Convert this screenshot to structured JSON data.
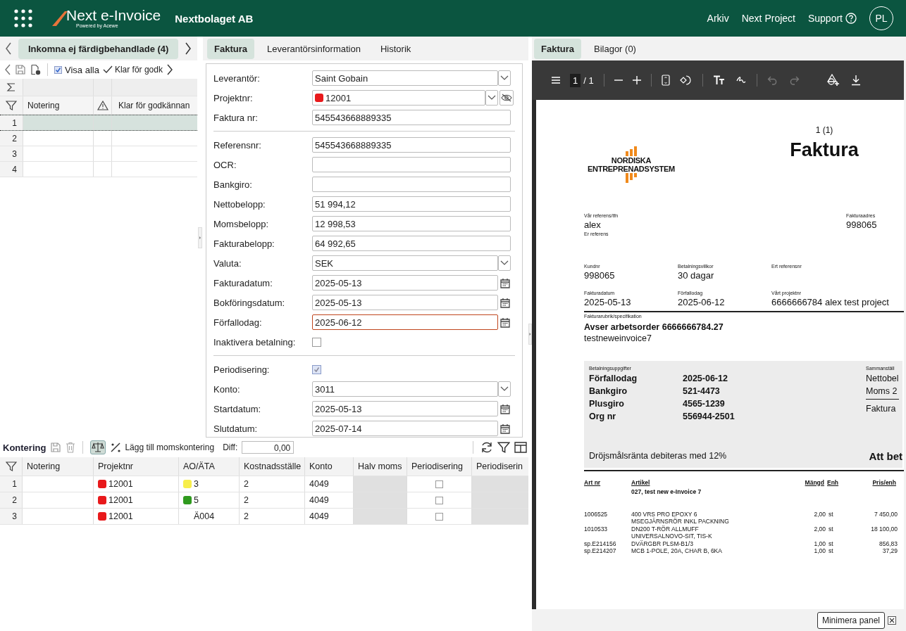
{
  "topbar": {
    "app_name": "Next e-Invoice",
    "powered_by": "Powered by Acewe",
    "company": "Nextbolaget AB",
    "links": [
      "Arkiv",
      "Next Project"
    ],
    "support": "Support",
    "avatar": "PL"
  },
  "list_panel": {
    "tab": "Inkomna ej färdigbehandlade (4)",
    "show_all": {
      "label": "Visa alla",
      "checked": true
    },
    "ready_button": "Klar för godk",
    "columns": [
      "Notering",
      "Klar för godkännan"
    ],
    "rows": [
      {
        "number": "1",
        "selected": true
      },
      {
        "number": "2",
        "selected": false
      },
      {
        "number": "3",
        "selected": false
      },
      {
        "number": "4",
        "selected": false
      }
    ]
  },
  "form_tabs": [
    {
      "label": "Faktura",
      "selected": true
    },
    {
      "label": "Leverantörsinformation",
      "selected": false
    },
    {
      "label": "Historik",
      "selected": false
    }
  ],
  "form_sections": [
    [
      {
        "kind": "select",
        "label": "Leverantör:",
        "value": "Saint Gobain"
      },
      {
        "kind": "project",
        "label": "Projektnr:",
        "value": "12001",
        "color": "#e8191b"
      },
      {
        "kind": "text",
        "label": "Faktura nr:",
        "value": "545543668889335"
      }
    ],
    [
      {
        "kind": "text",
        "label": "Referensnr:",
        "value": "545543668889335"
      },
      {
        "kind": "text",
        "label": "OCR:"
      },
      {
        "kind": "text",
        "label": "Bankgiro:"
      },
      {
        "kind": "text",
        "label": "Nettobelopp:",
        "value": "51 994,12"
      },
      {
        "kind": "text",
        "label": "Momsbelopp:",
        "value": "12 998,53"
      },
      {
        "kind": "text",
        "label": "Fakturabelopp:",
        "value": "64 992,65"
      },
      {
        "kind": "select",
        "label": "Valuta:",
        "value": "SEK"
      },
      {
        "kind": "date",
        "label": "Fakturadatum:",
        "value": "2025-05-13",
        "error": false
      },
      {
        "kind": "date",
        "label": "Bokföringsdatum:",
        "value": "2025-05-13",
        "error": false
      },
      {
        "kind": "date",
        "label": "Förfallodag:",
        "value": "2025-06-12",
        "error": true
      },
      {
        "kind": "checkbox",
        "label": "Inaktivera betalning:",
        "checked": false
      }
    ],
    [
      {
        "kind": "checkbox",
        "label": "Periodisering:",
        "checked": true
      },
      {
        "kind": "select",
        "label": "Konto:",
        "value": "3011"
      },
      {
        "kind": "date",
        "label": "Startdatum:",
        "value": "2025-05-13",
        "error": false
      },
      {
        "kind": "date",
        "label": "Slutdatum:",
        "value": "2025-07-14",
        "error": false
      }
    ]
  ],
  "kontering": {
    "title": "Kontering",
    "add_vat": "Lägg till momskontering",
    "diff_label": "Diff:",
    "diff_value": "0,00",
    "columns": [
      "Notering",
      "Projektnr",
      "AO/ÄTA",
      "Kostnadsställe",
      "Konto",
      "Halv moms",
      "Periodisering",
      "Periodiserin"
    ],
    "rows": [
      {
        "number": "1",
        "project": {
          "value": "12001",
          "color": "#e8191b"
        },
        "ao": {
          "value": "3",
          "color": "#f7ee4a"
        },
        "cost_center": "2",
        "account": "4049",
        "periodisering": false
      },
      {
        "number": "2",
        "project": {
          "value": "12001",
          "color": "#e8191b"
        },
        "ao": {
          "value": "5",
          "color": "#2f9a1e"
        },
        "cost_center": "2",
        "account": "4049",
        "periodisering": false
      },
      {
        "number": "3",
        "project": {
          "value": "12001",
          "color": "#e8191b"
        },
        "ao": {
          "value": "Ä004"
        },
        "cost_center": "2",
        "account": "4049",
        "periodisering": false
      }
    ]
  },
  "viewer_tabs": [
    {
      "label": "Faktura",
      "selected": true
    },
    {
      "label": "Bilagor (0)",
      "selected": false
    }
  ],
  "pdf_toolbar": {
    "page": "1",
    "total": "/ 1"
  },
  "document": {
    "page_label": "1 (1)",
    "title": "Faktura",
    "logo": [
      "NORDISKA",
      "ENTREPRENADSYSTEM"
    ],
    "our_ref_label": "Vår referens/tfn",
    "our_ref": "alex",
    "your_ref_label": "Er referens",
    "address_label": "Fakturaadres",
    "address": "998065",
    "info": [
      {
        "label": "Kundnr",
        "value": "998065"
      },
      {
        "label": "Betalningsvillkor",
        "value": "30 dagar"
      },
      {
        "label": "Ert referensnr"
      },
      {
        "label": "Fakturadatum",
        "value": "2025-05-13"
      },
      {
        "label": "Förfallodag",
        "value": "2025-06-12"
      },
      {
        "label": "Vårt projektnr",
        "value": "6666666784 alex test project"
      }
    ],
    "spec_label": "Fakturarubrik/specifikation",
    "heading": "Avser arbetsorder 6666666784.27",
    "subheading": "testneweinvoice7",
    "payment_label": "Betalningsuppgifter",
    "payment": [
      {
        "label": "Förfallodag",
        "value": "2025-06-12"
      },
      {
        "label": "Bankgiro",
        "value": "521-4473"
      },
      {
        "label": "Plusgiro",
        "value": "4565-1239"
      },
      {
        "label": "Org nr",
        "value": "556944-2501"
      }
    ],
    "summary_label": "Sammanställ",
    "summary": [
      "Nettobel",
      "Moms 2",
      "Faktura"
    ],
    "interest": "Dröjsmålsränta debiteras med 12%",
    "total": "Att bet",
    "item_columns": [
      "Art nr",
      "Artikel",
      "Mängd",
      "Enh",
      "Pris/enh"
    ],
    "item_group": "027, test new e-Invoice 7",
    "items": [
      {
        "art": "1006525",
        "description": [
          "400 VRS PRO EPOXY 6",
          "MSEGJÄRNSRÖR INKL PACKNING"
        ],
        "qty": "2,00",
        "unit": "st",
        "price": "7 450,00"
      },
      {
        "art": "1010533",
        "description": [
          "DN200 T-RÖR ALLMUFF",
          "UNIVERSALNOVO-SIT,  TIS-K"
        ],
        "qty": "2,00",
        "unit": "st",
        "price": "18 100,00"
      },
      {
        "art": "sp.E214156",
        "description": [
          "DVÄRGBR PLSM-B1/3"
        ],
        "qty": "1,00",
        "unit": "st",
        "price": "856,83"
      },
      {
        "art": "sp.E214207",
        "description": [
          "MCB 1-POLE, 20A, CHAR B,  6KA"
        ],
        "qty": "1,00",
        "unit": "st",
        "price": "37,29"
      }
    ]
  },
  "tooltip": "Minimera panel"
}
